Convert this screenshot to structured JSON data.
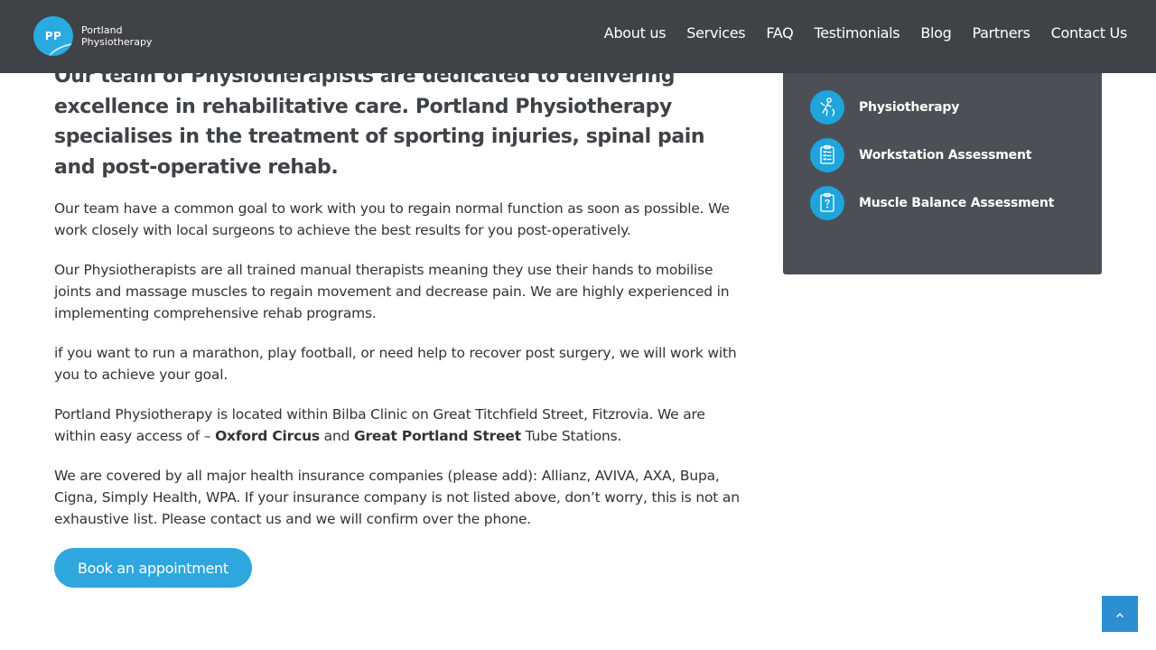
{
  "header": {
    "logo": {
      "initials": "PP",
      "line1": "Portland",
      "line2": "Physiotherapy"
    },
    "nav": [
      {
        "label": "About us"
      },
      {
        "label": "Services"
      },
      {
        "label": "FAQ"
      },
      {
        "label": "Testimonials"
      },
      {
        "label": "Blog"
      },
      {
        "label": "Partners"
      },
      {
        "label": "Contact Us"
      }
    ]
  },
  "main": {
    "lead": "Our team of Physiotherapists are dedicated to delivering excellence in rehabilitative care.  Portland Physiotherapy specialises in the treatment of sporting injuries, spinal pain and post-operative rehab.",
    "para1": "Our team have a common goal to work with you to regain normal function as soon as possible.  We work closely with local surgeons to achieve the best results for you post-operatively.",
    "para2": "Our Physiotherapists are all trained manual therapists meaning they use their hands to mobilise joints and massage muscles to regain movement and decrease pain.  We are highly experienced in implementing comprehensive rehab programs.",
    "para3": "if you want to run a marathon, play football, or need help to recover post surgery,  we will work with you to achieve your goal.",
    "para4": {
      "before": "Portland Physiotherapy is located within Bilba Clinic on Great Titchfield Street, Fitzrovia. We are within easy access of – ",
      "station1": "Oxford Circus",
      "and": " and ",
      "station2": "Great Portland Street",
      "after": " Tube Stations."
    },
    "para5": "We are covered by all major health insurance companies (please add): Allianz, AVIVA, AXA, Bupa, Cigna, Simply Health, WPA. If your insurance company is not listed above, don’t worry, this is not an exhaustive list. Please contact us and we will confirm over the phone.",
    "book_button": "Book an appointment"
  },
  "sidebar": {
    "items": [
      {
        "label": "Physiotherapy",
        "icon": "physiotherapy-icon"
      },
      {
        "label": "Workstation Assessment",
        "icon": "clipboard-list-icon"
      },
      {
        "label": "Muscle Balance Assessment",
        "icon": "clipboard-question-icon"
      }
    ]
  },
  "colors": {
    "header_bg": "#3f4247",
    "sidebar_bg": "#4c5056",
    "accent": "#29abe2",
    "scroll_top_bg": "#2b8fd2"
  },
  "scroll_top": {
    "icon": "chevron-up-icon"
  }
}
